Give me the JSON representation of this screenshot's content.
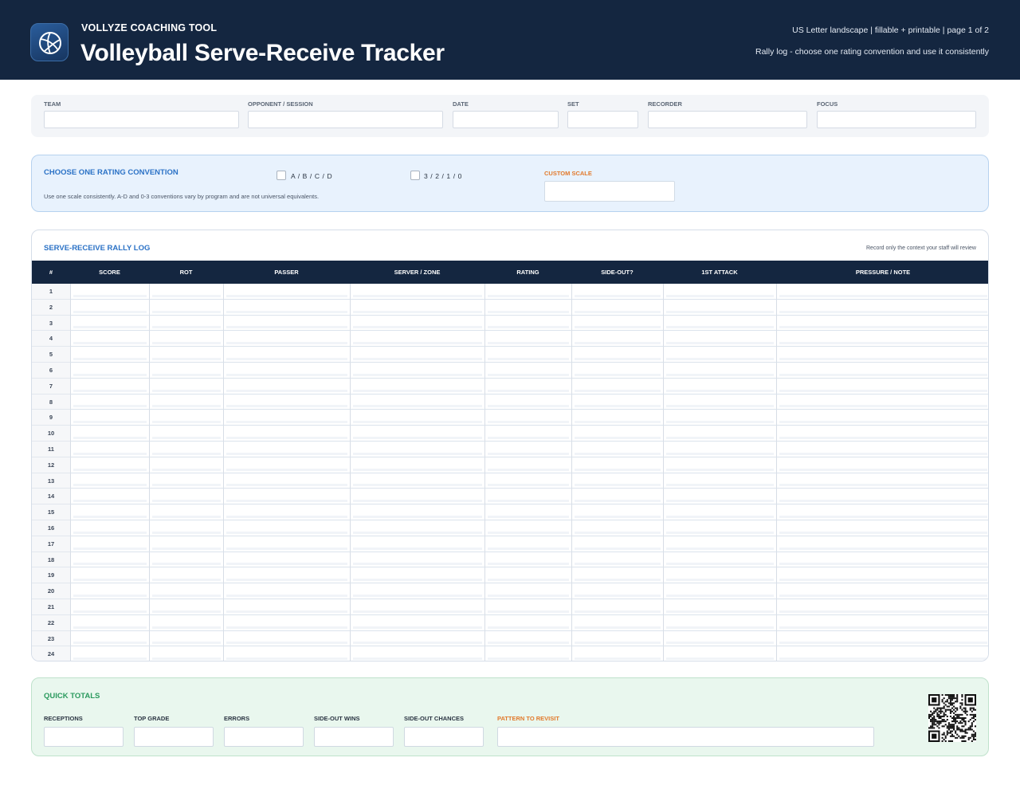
{
  "header": {
    "brand": "VOLLYZE COACHING TOOL",
    "title": "Volleyball Serve-Receive Tracker",
    "meta_line1": "US Letter landscape | fillable + printable | page 1 of 2",
    "meta_line2": "Rally log - choose one rating convention and use it consistently",
    "logo_icon": "volleyball-icon"
  },
  "info_fields": [
    {
      "label": "TEAM"
    },
    {
      "label": "OPPONENT / SESSION"
    },
    {
      "label": "DATE"
    },
    {
      "label": "SET"
    },
    {
      "label": "RECORDER"
    },
    {
      "label": "FOCUS"
    }
  ],
  "convention": {
    "title": "CHOOSE ONE RATING CONVENTION",
    "option1": "A / B / C / D",
    "option2": "3 / 2 / 1 / 0",
    "custom_label": "CUSTOM SCALE",
    "note": "Use one scale consistently. A-D and 0-3 conventions vary by program and are not universal equivalents."
  },
  "log": {
    "title": "SERVE-RECEIVE RALLY LOG",
    "note": "Record only the context your staff will review",
    "columns": [
      "#",
      "SCORE",
      "ROT",
      "PASSER",
      "SERVER / ZONE",
      "RATING",
      "SIDE-OUT?",
      "1ST ATTACK",
      "PRESSURE / NOTE"
    ],
    "rows": [
      "1",
      "2",
      "3",
      "4",
      "5",
      "6",
      "7",
      "8",
      "9",
      "10",
      "11",
      "12",
      "13",
      "14",
      "15",
      "16",
      "17",
      "18",
      "19",
      "20",
      "21",
      "22",
      "23",
      "24"
    ]
  },
  "totals": {
    "title": "QUICK TOTALS",
    "fields": [
      "RECEPTIONS",
      "TOP GRADE",
      "ERRORS",
      "SIDE-OUT WINS",
      "SIDE-OUT CHANCES"
    ],
    "pattern_label": "PATTERN TO REVISIT",
    "qr_icon": "qr-code-icon"
  },
  "colors": {
    "navy": "#142640",
    "accent_blue": "#2b72c6",
    "accent_orange": "#e27a2c",
    "accent_green": "#2b9a5e"
  }
}
